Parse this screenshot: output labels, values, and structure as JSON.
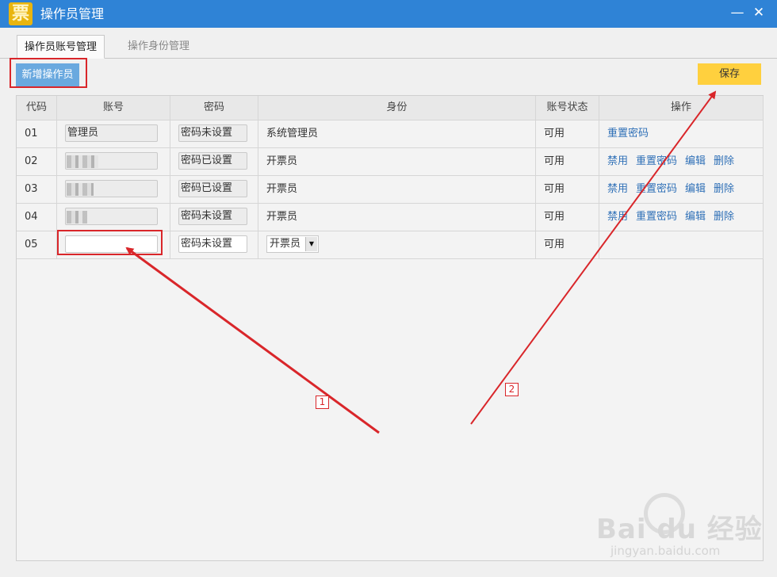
{
  "window": {
    "logo_char": "票",
    "title": "操作员管理",
    "minimize": "—",
    "close": "✕"
  },
  "tabs": [
    {
      "label": "操作员账号管理",
      "active": true
    },
    {
      "label": "操作身份管理",
      "active": false
    }
  ],
  "toolbar": {
    "add_label": "新增操作员",
    "save_label": "保存"
  },
  "table": {
    "headers": [
      "代码",
      "账号",
      "密码",
      "身份",
      "账号状态",
      "操作"
    ],
    "rows": [
      {
        "code": "01",
        "account": "管理员",
        "password": "密码未设置",
        "role": "系统管理员",
        "status": "可用",
        "ops": [
          "重置密码"
        ]
      },
      {
        "code": "02",
        "account": "",
        "password": "密码已设置",
        "role": "开票员",
        "status": "可用",
        "ops": [
          "禁用",
          "重置密码",
          "编辑",
          "删除"
        ]
      },
      {
        "code": "03",
        "account": "",
        "password": "密码已设置",
        "role": "开票员",
        "status": "可用",
        "ops": [
          "禁用",
          "重置密码",
          "编辑",
          "删除"
        ]
      },
      {
        "code": "04",
        "account": "",
        "password": "密码未设置",
        "role": "开票员",
        "status": "可用",
        "ops": [
          "禁用",
          "重置密码",
          "编辑",
          "删除"
        ]
      },
      {
        "code": "05",
        "account": "",
        "password": "密码未设置",
        "role": "开票员",
        "status": "可用",
        "ops": []
      }
    ]
  },
  "annotations": {
    "label_1": "1",
    "label_2": "2",
    "color": "#d9262a"
  },
  "watermark": {
    "brand": "Bai  du 经验",
    "url": "jingyan.baidu.com"
  },
  "colors": {
    "titlebar": "#2f83d6",
    "add_button": "#6aa9df",
    "save_button": "#ffd03e",
    "link": "#2f70b7"
  }
}
